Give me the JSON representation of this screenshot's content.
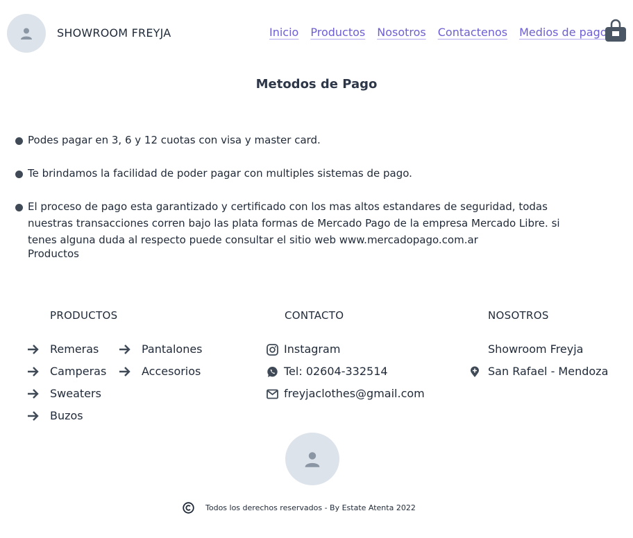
{
  "header": {
    "brand": "SHOWROOM FREYJA",
    "nav": [
      "Inicio",
      "Productos",
      "Nosotros",
      "Contactenos",
      "Medios de pago"
    ]
  },
  "main": {
    "title": "Metodos de Pago",
    "bullets": [
      "Podes pagar en 3, 6 y 12 cuotas con visa y master card.",
      "Te brindamos la facilidad de poder pagar con multiples sistemas de pago.",
      "El proceso de pago esta garantizado y certificado con los mas altos estandares de seguridad, todas nuestras transacciones corren bajo las plata formas de Mercado Pago de la empresa Mercado Libre. si tenes alguna duda al respecto puede consultar el sitio web www.mercadopago.com.ar"
    ],
    "extra": "Productos"
  },
  "footer": {
    "productos": {
      "title": "PRODUCTOS",
      "items": [
        "Remeras",
        "Pantalones",
        "Camperas",
        "Accesorios",
        "Sweaters",
        "Buzos"
      ]
    },
    "contacto": {
      "title": "CONTACTO",
      "instagram": "Instagram",
      "tel": "Tel: 02604-332514",
      "email": "freyjaclothes@gmail.com"
    },
    "nosotros": {
      "title": "NOSOTROS",
      "name": "Showroom Freyja",
      "location": "San Rafael - Mendoza"
    },
    "copyright": "Todos los derechos reservados - By Estate Atenta 2022"
  },
  "icons": {
    "avatar": "user-icon",
    "cart": "shopping-bag-icon",
    "arrow": "arrow-right-icon",
    "instagram": "instagram-icon",
    "whatsapp": "whatsapp-icon",
    "email": "mail-icon",
    "location": "location-pin-icon",
    "copyright": "copyright-icon"
  },
  "colors": {
    "link": "#6d5fd3",
    "avatar_bg": "#dde3ea",
    "icon": "#3f4a56"
  }
}
